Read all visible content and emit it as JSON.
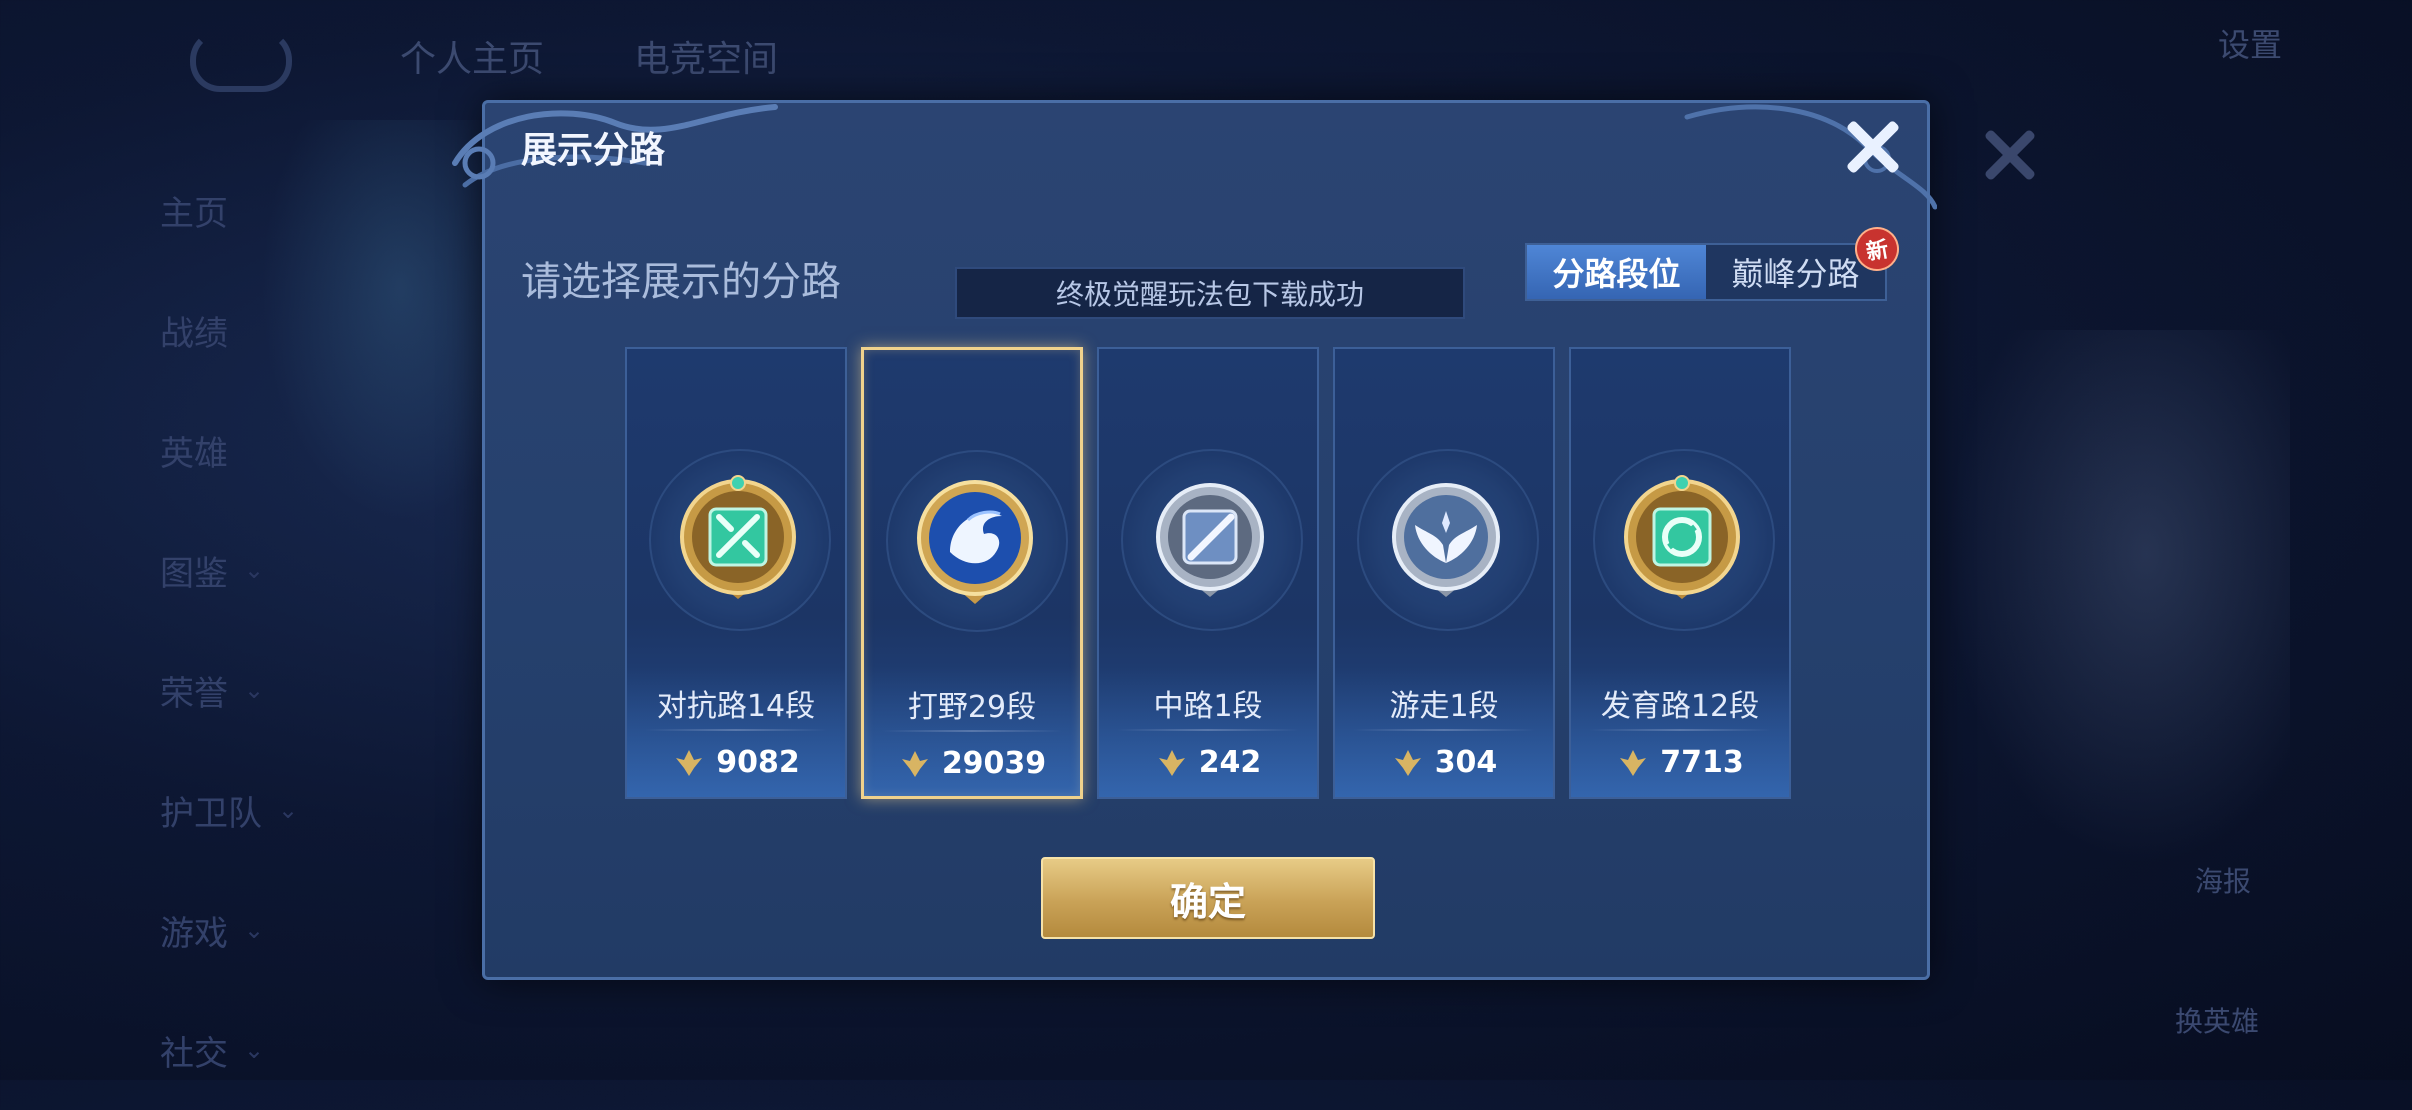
{
  "background": {
    "tabs": [
      "个人主页",
      "电竞空间"
    ],
    "sidebar": [
      {
        "label": "主页",
        "chevron": false
      },
      {
        "label": "战绩",
        "chevron": false
      },
      {
        "label": "英雄",
        "chevron": false
      },
      {
        "label": "图鉴",
        "chevron": true
      },
      {
        "label": "荣誉",
        "chevron": true
      },
      {
        "label": "护卫队",
        "chevron": true
      },
      {
        "label": "游戏",
        "chevron": true
      },
      {
        "label": "社交",
        "chevron": true
      }
    ],
    "settings_label": "设置",
    "poster_label": "海报",
    "swap_hero_label": "换英雄"
  },
  "modal": {
    "title": "展示分路",
    "subtitle": "请选择展示的分路",
    "toast": "终极觉醒玩法包下载成功",
    "segment": {
      "tabs": [
        "分路段位",
        "巅峰分路"
      ],
      "active_index": 0,
      "new_badge": "新"
    },
    "cards": [
      {
        "rank": "对抗路14段",
        "score": "9082",
        "emblem": "clash-lane-emblem",
        "tier": "gold",
        "selected": false
      },
      {
        "rank": "打野29段",
        "score": "29039",
        "emblem": "jungle-dragon-emblem",
        "tier": "gold",
        "selected": true
      },
      {
        "rank": "中路1段",
        "score": "242",
        "emblem": "mid-lane-emblem",
        "tier": "silver",
        "selected": false
      },
      {
        "rank": "游走1段",
        "score": "304",
        "emblem": "roam-wings-emblem",
        "tier": "silver",
        "selected": false
      },
      {
        "rank": "发育路12段",
        "score": "7713",
        "emblem": "farm-lane-emblem",
        "tier": "gold",
        "selected": false
      }
    ],
    "confirm_label": "确定"
  },
  "colors": {
    "modal_bg": "#25406d",
    "gold": "#d8b463",
    "selected_border": "#f0d28c",
    "active_tab": "#3f74c4"
  }
}
